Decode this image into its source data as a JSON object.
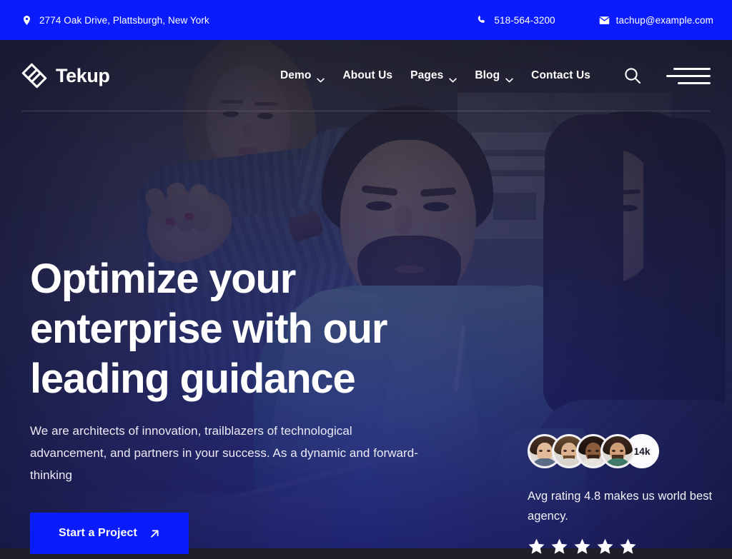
{
  "topbar": {
    "address": "2774 Oak Drive, Plattsburgh, New York",
    "address_icon": "map-pin-icon",
    "phone": "518-564-3200",
    "phone_icon": "phone-icon",
    "email": "tachup@example.com",
    "email_icon": "envelope-icon",
    "background_color": "#0a1cfb",
    "text_color": "#ffffff"
  },
  "header": {
    "brand_name": "Tekup",
    "brand_icon": "diamond-layers-logo-icon",
    "nav": [
      {
        "label": "Demo",
        "has_dropdown": true
      },
      {
        "label": "About Us",
        "has_dropdown": false
      },
      {
        "label": "Pages",
        "has_dropdown": true
      },
      {
        "label": "Blog",
        "has_dropdown": true
      },
      {
        "label": "Contact Us",
        "has_dropdown": false
      }
    ],
    "search_icon": "search-icon",
    "menu_icon": "hamburger-menu-icon"
  },
  "hero": {
    "headline": "Optimize your enterprise with our leading guidance",
    "subtext": "We are architects of innovation, trailblazers of technological advancement, and partners in your success. As a dynamic and forward-thinking",
    "cta_label": "Start a Project",
    "cta_icon": "arrow-up-right-icon",
    "cta_color": "#0a1cfb",
    "overlay_top_color": "#1a1a22",
    "overlay_bottom_color": "#2024961",
    "background_description": "Team of three colleagues working together at a desk in an office"
  },
  "social_proof": {
    "avatar_count_badge": "14k",
    "avatars": [
      {
        "name": "avatar-1"
      },
      {
        "name": "avatar-2"
      },
      {
        "name": "avatar-3"
      },
      {
        "name": "avatar-4"
      }
    ],
    "rating_text": "Avg rating 4.8 makes us world best agency.",
    "rating_value": 4.8,
    "star_count": 5,
    "star_color": "#ffffff"
  }
}
